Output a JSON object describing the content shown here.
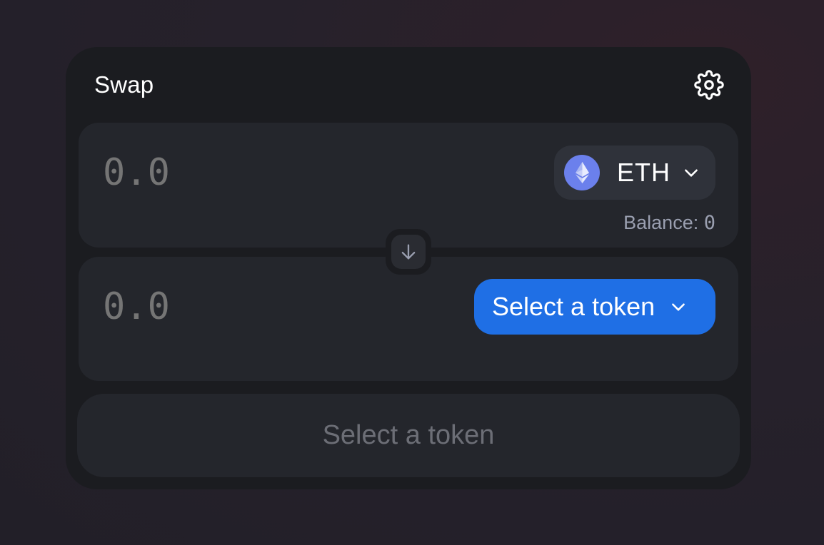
{
  "header": {
    "title": "Swap",
    "settings_icon": "gear-icon"
  },
  "input_panel": {
    "amount_placeholder": "0.0",
    "token": {
      "symbol": "ETH",
      "logo_icon": "ethereum-icon",
      "logo_color": "#6b80ec"
    },
    "balance_label": "Balance:",
    "balance_value": "0"
  },
  "switch_direction_icon": "arrow-down-icon",
  "output_panel": {
    "amount_placeholder": "0.0",
    "select_token_label": "Select a token",
    "select_token_color": "#1f6fe5"
  },
  "action_button": {
    "label": "Select a token",
    "disabled": true
  }
}
